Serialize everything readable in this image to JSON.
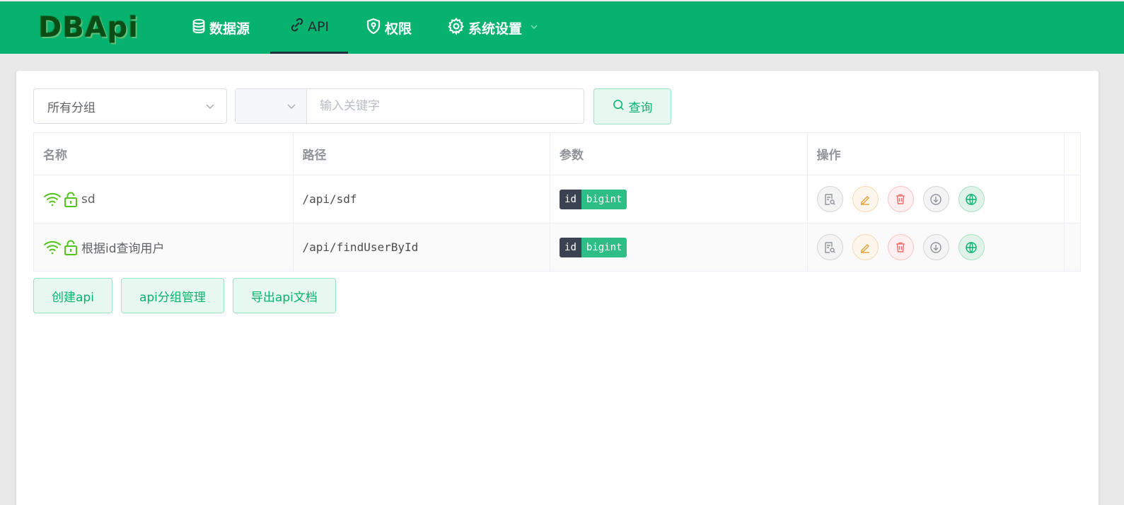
{
  "app": {
    "logo": "DBApi"
  },
  "nav": {
    "datasource": "数据源",
    "api": "API",
    "permission": "权限",
    "settings": "系统设置"
  },
  "filters": {
    "group_selected": "所有分组",
    "prefix_selected": "",
    "search_placeholder": "输入关键字",
    "query_button": "查询"
  },
  "table": {
    "headers": [
      "名称",
      "路径",
      "参数",
      "操作"
    ],
    "rows": [
      {
        "name": "sd",
        "path": "/api/sdf",
        "param_name": "id",
        "param_type": "bigint",
        "online_icon": "wifi-icon",
        "lock_icon": "unlock-icon"
      },
      {
        "name": "根据id查询用户",
        "path": "/api/findUserById",
        "param_name": "id",
        "param_type": "bigint",
        "online_icon": "wifi-icon",
        "lock_icon": "unlock-icon"
      }
    ],
    "operations": [
      "view-detail-icon",
      "edit-icon",
      "delete-icon",
      "download-icon",
      "publish-icon"
    ]
  },
  "actions": {
    "create": "创建api",
    "group_manage": "api分组管理",
    "export_doc": "导出api文档"
  },
  "colors": {
    "brand": "#07b26f",
    "header_text": "#ffffff",
    "tag_key": "#3b4252",
    "tag_value": "#2ebd85"
  }
}
